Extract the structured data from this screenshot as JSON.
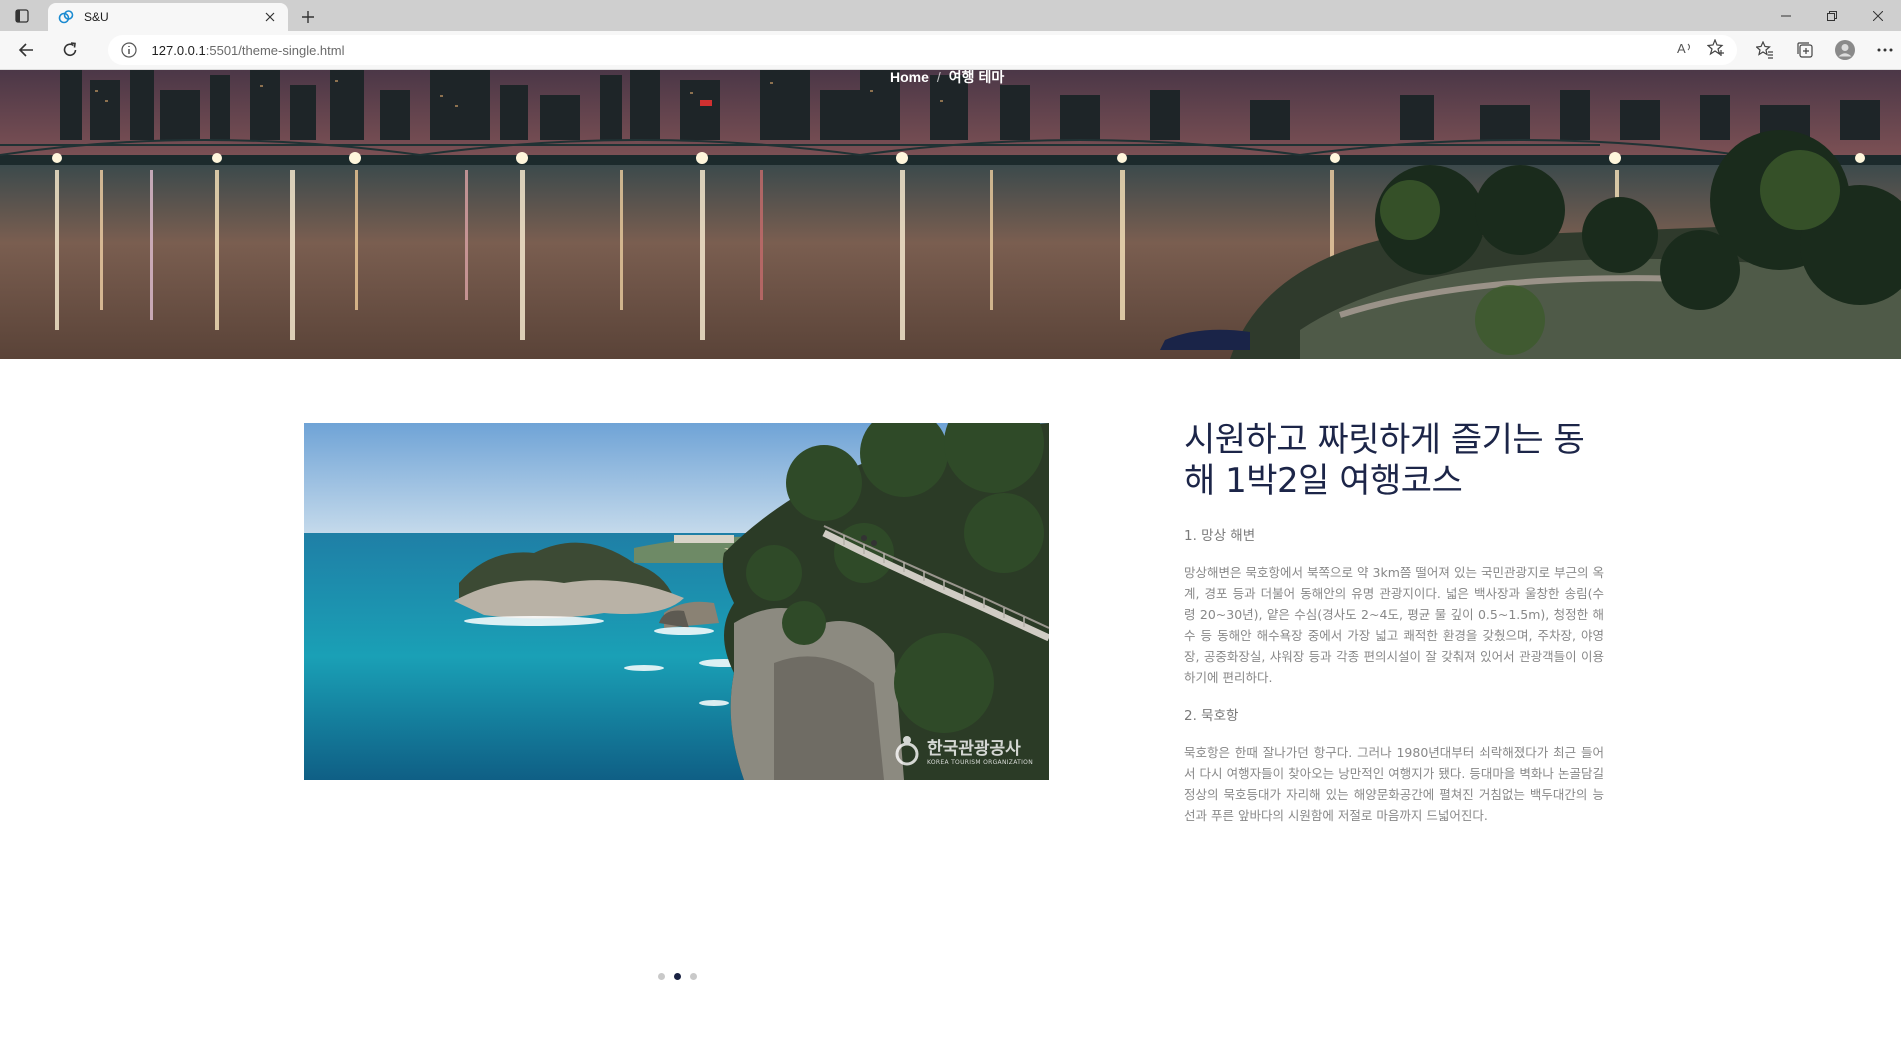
{
  "browser": {
    "tab_title": "S&U",
    "url_host": "127.0.0.1",
    "url_rest": ":5501/theme-single.html"
  },
  "breadcrumb": {
    "home": "Home",
    "separator": "/",
    "current": "여행 테마"
  },
  "article": {
    "title": "시원하고 짜릿하게 즐기는 동해 1박2일 여행코스",
    "sections": [
      {
        "heading": "1. 망상 해변",
        "body": "망상해변은 묵호항에서 북쪽으로 약 3km쯤 떨어져 있는 국민관광지로 부근의 옥계, 경포 등과 더불어 동해안의 유명 관광지이다. 넓은 백사장과 울창한 송림(수령 20~30년), 얕은 수심(경사도 2~4도, 평균 물 깊이 0.5~1.5m), 청정한 해수 등 동해안 해수욕장 중에서 가장 넓고 쾌적한 환경을 갖췄으며, 주차장, 야영장, 공중화장실, 샤워장 등과 각종 편의시설이 잘 갖춰져 있어서 관광객들이 이용하기에 편리하다."
      },
      {
        "heading": "2. 묵호항",
        "body": "묵호항은 한때 잘나가던 항구다. 그러나 1980년대부터 쇠락해졌다가 최근 들어서 다시 여행자들이 찾아오는 낭만적인 여행지가 됐다. 등대마을 벽화나 논골담길 정상의 묵호등대가 자리해 있는 해양문화공간에 펼쳐진 거침없는 백두대간의 능선과 푸른 앞바다의 시원함에 저절로 마음까지 드넓어진다."
      }
    ]
  },
  "photo": {
    "watermark_ko": "한국관광공사",
    "watermark_en": "KOREA TOURISM ORGANIZATION"
  },
  "carousel": {
    "total": 3,
    "active": 2
  }
}
